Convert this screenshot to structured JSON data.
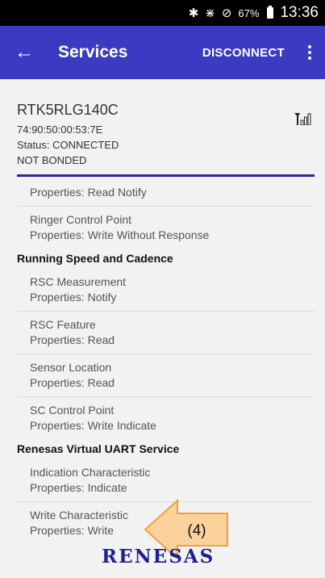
{
  "status_bar": {
    "icons": [
      "bluetooth-icon",
      "vibrate-icon",
      "do-not-disturb-icon",
      "battery-icon"
    ],
    "battery": "67%",
    "time": "13:36"
  },
  "app_bar": {
    "title": "Services",
    "action": "DISCONNECT",
    "background": "#3a3ac2"
  },
  "device": {
    "name": "RTK5RLG140C",
    "address": "74:90:50:00:53:7E",
    "status": "Status:  CONNECTED",
    "bond": "NOT BONDED"
  },
  "list": {
    "partial_item": {
      "properties": "Properties: Read Notify"
    },
    "ringer_control_point": {
      "name": "Ringer Control Point",
      "properties": "Properties: Write Without Response"
    },
    "rsc_service": {
      "header": "Running Speed and Cadence",
      "items": [
        {
          "name": "RSC Measurement",
          "properties": "Properties: Notify"
        },
        {
          "name": "RSC Feature",
          "properties": "Properties: Read"
        },
        {
          "name": "Sensor Location",
          "properties": "Properties: Read"
        },
        {
          "name": "SC Control Point",
          "properties": "Properties: Write Indicate"
        }
      ]
    },
    "uart_service": {
      "header": "Renesas Virtual UART Service",
      "items": [
        {
          "name": "Indication Characteristic",
          "properties": "Properties: Indicate"
        },
        {
          "name": "Write Characteristic",
          "properties": "Properties: Write"
        }
      ]
    }
  },
  "annotation": {
    "label": "(4)",
    "fill": "#fbd29b",
    "stroke": "#f0a040"
  },
  "logo": {
    "text": "RENESAS",
    "color": "#1f1f8f"
  }
}
